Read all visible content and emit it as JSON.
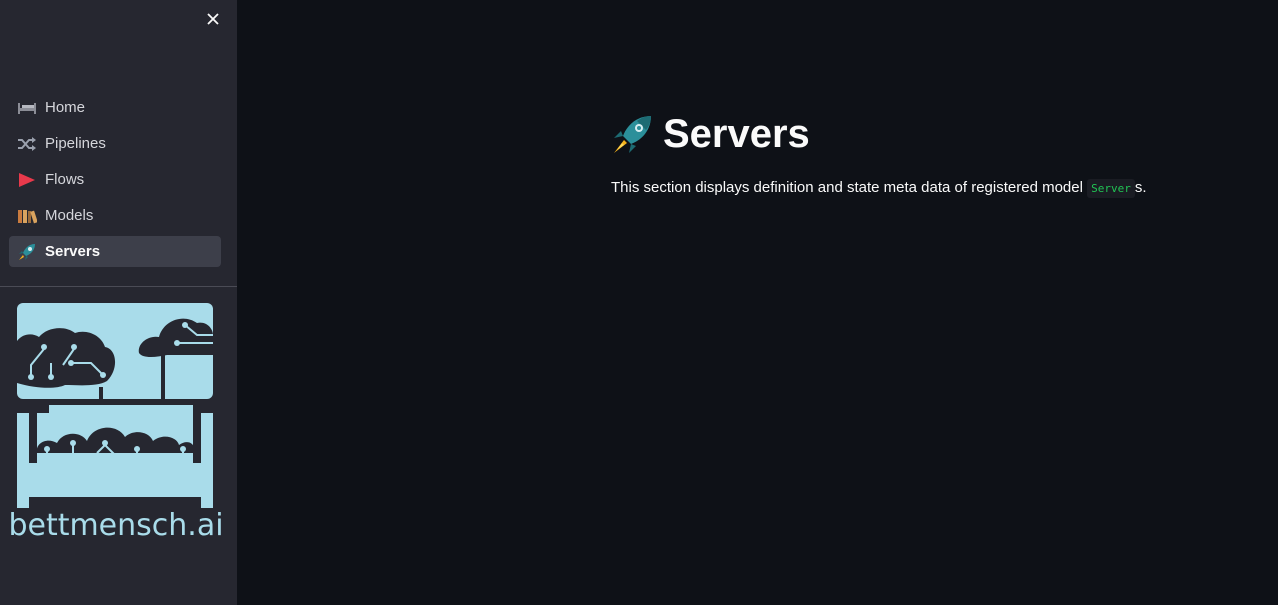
{
  "sidebar": {
    "close_icon": "close-icon",
    "items": [
      {
        "label": "Home",
        "icon": "bed-icon"
      },
      {
        "label": "Pipelines",
        "icon": "shuffle-icon"
      },
      {
        "label": "Flows",
        "icon": "play-triangle-icon"
      },
      {
        "label": "Models",
        "icon": "books-icon"
      },
      {
        "label": "Servers",
        "icon": "rocket-icon",
        "active": true
      }
    ],
    "logo_text": "bettmensch.ai"
  },
  "main": {
    "title": "Servers",
    "title_icon": "rocket-icon",
    "description_prefix": "This section displays definition and state meta data of registered model ",
    "description_code": "Server",
    "description_suffix": "s."
  },
  "colors": {
    "background": "#0e1117",
    "sidebar": "#262730",
    "active_item": "#3d3f4a",
    "logo": "#a9dcea",
    "code_text": "#21c354"
  }
}
